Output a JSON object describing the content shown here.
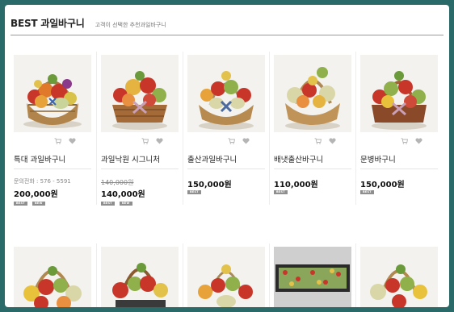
{
  "header": {
    "title": "BEST 과일바구니",
    "subtitle": "고객이 선택한 추천과일바구니"
  },
  "colors": {
    "frame": "#2a6b6a",
    "badge": "#8f8f8f",
    "price": "#111111"
  },
  "products": [
    {
      "name": "특대 과일바구니",
      "inquiry": "문의전화 : 576 - 5591",
      "old_price": "",
      "price": "200,000원",
      "badges": [
        "BEST",
        "NEW"
      ]
    },
    {
      "name": "과일낙원 시그니처",
      "inquiry": "",
      "old_price": "140,000원",
      "price": "140,000원",
      "badges": [
        "BEST",
        "NEW"
      ]
    },
    {
      "name": "출산과일바구니",
      "inquiry": "",
      "old_price": "",
      "price": "150,000원",
      "badges": [
        "BEST"
      ]
    },
    {
      "name": "배냇출산바구니",
      "inquiry": "",
      "old_price": "",
      "price": "110,000원",
      "badges": [
        "BEST"
      ]
    },
    {
      "name": "문병바구니",
      "inquiry": "",
      "old_price": "",
      "price": "150,000원",
      "badges": [
        "BEST"
      ]
    }
  ],
  "row2_thumbnails": [
    "basket",
    "basket",
    "basket",
    "tray",
    "basket"
  ],
  "icons": {
    "cart": "cart-icon",
    "wishlist": "heart-icon"
  }
}
